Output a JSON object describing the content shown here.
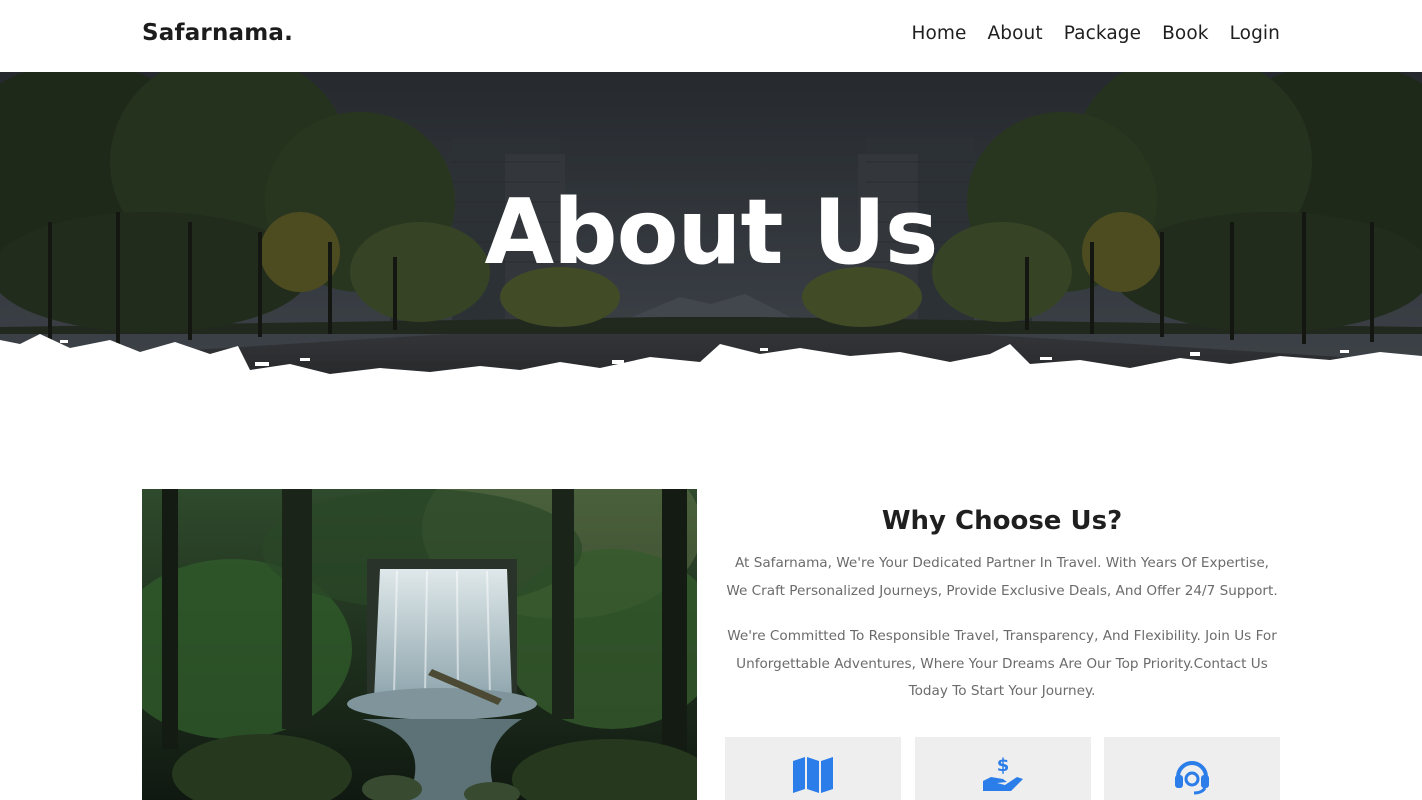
{
  "header": {
    "logo": "Safarnama.",
    "nav": [
      {
        "label": "Home"
      },
      {
        "label": "About"
      },
      {
        "label": "Package"
      },
      {
        "label": "Book"
      },
      {
        "label": "Login"
      }
    ]
  },
  "hero": {
    "title": "About Us"
  },
  "about": {
    "heading": "Why Choose Us?",
    "paragraph_1": "At Safarnama, We're Your Dedicated Partner In Travel. With Years Of Expertise, We Craft Personalized Journeys, Provide Exclusive Deals, And Offer 24/7 Support.",
    "paragraph_2": "We're Committed To Responsible Travel, Transparency, And Flexibility. Join Us For Unforgettable Adventures, Where Your Dreams Are Our Top Priority.Contact Us Today To Start Your Journey."
  },
  "features": [
    {
      "icon": "map-icon"
    },
    {
      "icon": "money-hand-icon"
    },
    {
      "icon": "headset-support-icon"
    }
  ],
  "colors": {
    "accent": "#2b7de9",
    "feature_bg": "#eeeeee",
    "text_muted": "#6b6b6b"
  }
}
